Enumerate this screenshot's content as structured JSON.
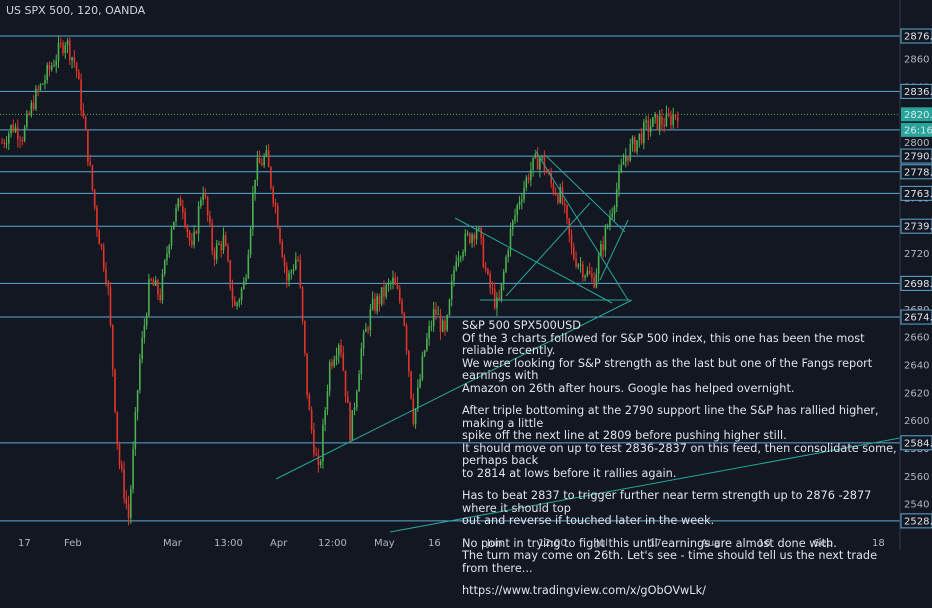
{
  "header": {
    "symbol": "US SPX 500, 120, OANDA"
  },
  "note": {
    "title": "S&P 500 SPX500USD",
    "p1": [
      "Of the 3 charts followed for S&P 500 index, this one has been the most reliable recently.",
      "We were looking for S&P strength as the last but one of the Fangs report earnings with",
      "Amazon on 26th after hours. Google has helped overnight."
    ],
    "p2": [
      "After triple bottoming at the 2790 support line the S&P has rallied higher, making a little",
      "spike off the next line at 2809 before pushing  higher still.",
      "It should move on up to test 2836-2837 on this feed, then consolidate some, perhaps back",
      "to 2814 at lows before it rallies again."
    ],
    "p3": [
      "Has to beat 2837 to trigger further near term strength up to 2876 -2877 where it should top",
      "out and reverse if touched later in the week."
    ],
    "p4": [
      "No point in trying to fight this until earnings are almost done with.",
      "The turn may come on 26th. Let's see - time should tell us the next trade from there..."
    ],
    "link": "https://www.tradingview.com/x/gObOVwLk/"
  },
  "chart_data": {
    "type": "candlestick",
    "title": "US SPX 500, 120, OANDA",
    "ylim": [
      2520,
      2888
    ],
    "y_ticks": [
      2540,
      2560,
      2580,
      2600,
      2620,
      2640,
      2660,
      2680,
      2700,
      2720,
      2740,
      2760,
      2780,
      2800,
      2820,
      2840,
      2860
    ],
    "x_ticks": [
      "17",
      "Feb",
      "Mar",
      "13:00",
      "Apr",
      "12:00",
      "May",
      "16",
      "Jun",
      "12:00",
      "Jul",
      "17",
      "Aug",
      "16",
      "Sep",
      "18"
    ],
    "horizontal_levels": [
      2876.5,
      2836.7,
      2820.2,
      2809,
      2790.2,
      2778.9,
      2763.4,
      2739.8,
      2698.7,
      2674.5,
      2584.1,
      2528.0
    ],
    "price_labels": [
      "2876.5",
      "2836.7",
      "2820.2",
      "26:16",
      "2790.2",
      "2778.9",
      "2763.4",
      "2739.8",
      "2698.7",
      "2674.5",
      "2584.1",
      "2528.0"
    ],
    "current_price": 2820.2,
    "countdown": "26:16",
    "price_path": [
      2800,
      2812,
      2805,
      2830,
      2845,
      2860,
      2874,
      2855,
      2800,
      2740,
      2700,
      2575,
      2530,
      2640,
      2700,
      2690,
      2740,
      2760,
      2720,
      2770,
      2720,
      2730,
      2680,
      2700,
      2780,
      2790,
      2750,
      2700,
      2720,
      2610,
      2560,
      2640,
      2660,
      2590,
      2650,
      2680,
      2690,
      2700,
      2680,
      2600,
      2650,
      2680,
      2660,
      2720,
      2730,
      2740,
      2700,
      2680,
      2730,
      2760,
      2780,
      2790,
      2770,
      2760,
      2720,
      2710,
      2700,
      2730,
      2760,
      2790,
      2800,
      2810,
      2815,
      2815,
      2822
    ],
    "up_color": "#4caf50",
    "down_color": "#e0352b"
  }
}
